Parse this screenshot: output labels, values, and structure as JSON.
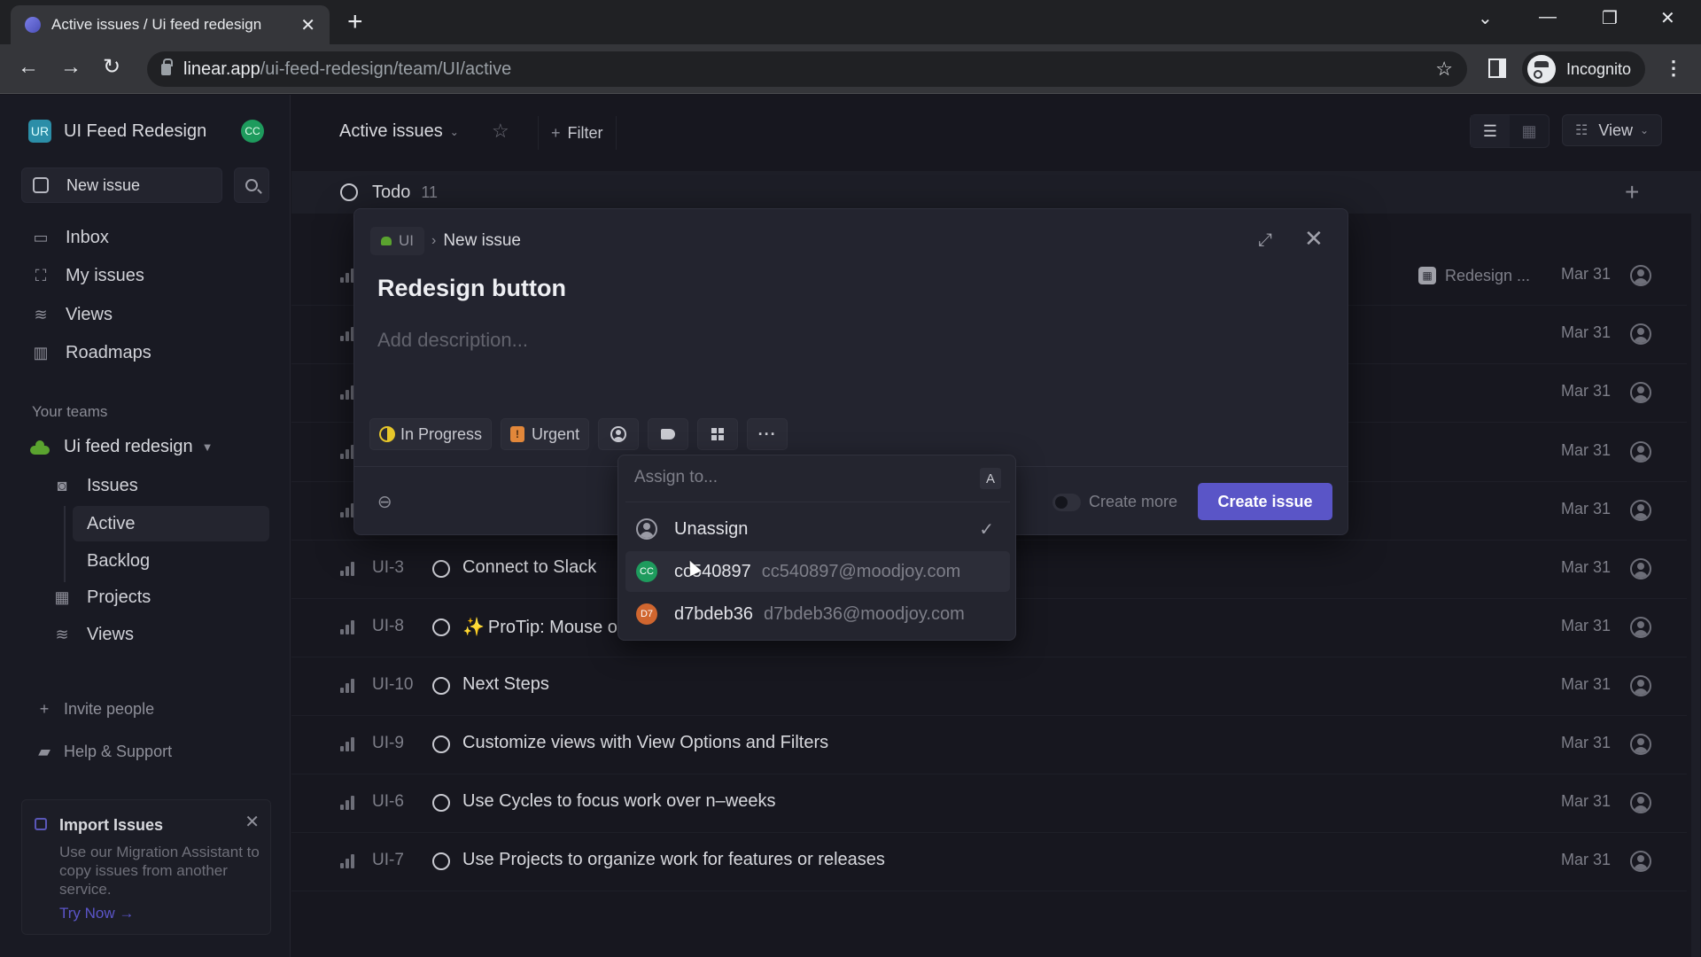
{
  "browser": {
    "tab_title": "Active issues / Ui feed redesign",
    "url_host": "linear.app",
    "url_path": "/ui-feed-redesign/team/UI/active",
    "profile_label": "Incognito"
  },
  "sidebar": {
    "workspace_initials": "UR",
    "workspace_name": "UI Feed Redesign",
    "user_initials": "CC",
    "new_issue_label": "New issue",
    "nav": [
      {
        "label": "Inbox",
        "icon": "inbox-icon"
      },
      {
        "label": "My issues",
        "icon": "my-issues-icon"
      },
      {
        "label": "Views",
        "icon": "views-icon"
      },
      {
        "label": "Roadmaps",
        "icon": "roadmaps-icon"
      }
    ],
    "teams_label": "Your teams",
    "team_name": "Ui feed redesign",
    "team_items": {
      "issues": "Issues",
      "active": "Active",
      "backlog": "Backlog",
      "projects": "Projects",
      "views": "Views"
    },
    "invite_label": "Invite people",
    "help_label": "Help & Support",
    "import_card": {
      "title": "Import Issues",
      "description": "Use our Migration Assistant to copy issues from another service.",
      "cta": "Try Now →"
    }
  },
  "header": {
    "title": "Active issues",
    "filter_label": "Filter",
    "view_label": "View"
  },
  "group": {
    "label": "Todo",
    "count": "11"
  },
  "issues": [
    {
      "id": "--",
      "title": "",
      "project": "Redesign ...",
      "date": "Mar 31"
    },
    {
      "id": "",
      "title": "",
      "date": "Mar 31"
    },
    {
      "id": "",
      "title": "",
      "date": "Mar 31"
    },
    {
      "id": "",
      "title": "",
      "date": "Mar 31"
    },
    {
      "id": "",
      "title": "",
      "date": "Mar 31"
    },
    {
      "id": "UI-3",
      "title": "Connect to Slack",
      "date": "Mar 31"
    },
    {
      "id": "UI-8",
      "title": "ProTip: Mouse o",
      "sparkle": "✨",
      "date": "Mar 31"
    },
    {
      "id": "UI-10",
      "title": "Next Steps",
      "date": "Mar 31"
    },
    {
      "id": "UI-9",
      "title": "Customize views with View Options and Filters",
      "date": "Mar 31"
    },
    {
      "id": "UI-6",
      "title": "Use Cycles to focus work over n–weeks",
      "date": "Mar 31"
    },
    {
      "id": "UI-7",
      "title": "Use Projects to organize work for features or releases",
      "date": "Mar 31"
    }
  ],
  "modal": {
    "team_chip": "UI",
    "breadcrumb_current": "New issue",
    "title": "Redesign button",
    "description_placeholder": "Add description...",
    "status_label": "In Progress",
    "priority_label": "Urgent",
    "priority_glyph": "!",
    "more_glyph": "···",
    "create_more_label": "Create more",
    "create_button": "Create issue",
    "accent": "#5a55c7"
  },
  "assign_dropdown": {
    "placeholder": "Assign to...",
    "shortcut": "A",
    "options": [
      {
        "name": "Unassign",
        "email": "",
        "selected": true
      },
      {
        "name": "cc540897",
        "email": "cc540897@moodjoy.com",
        "initials": "CC",
        "color": "#1e9b5d"
      },
      {
        "name": "d7bdeb36",
        "email": "d7bdeb36@moodjoy.com",
        "initials": "D7",
        "color": "#d0662f"
      }
    ]
  }
}
